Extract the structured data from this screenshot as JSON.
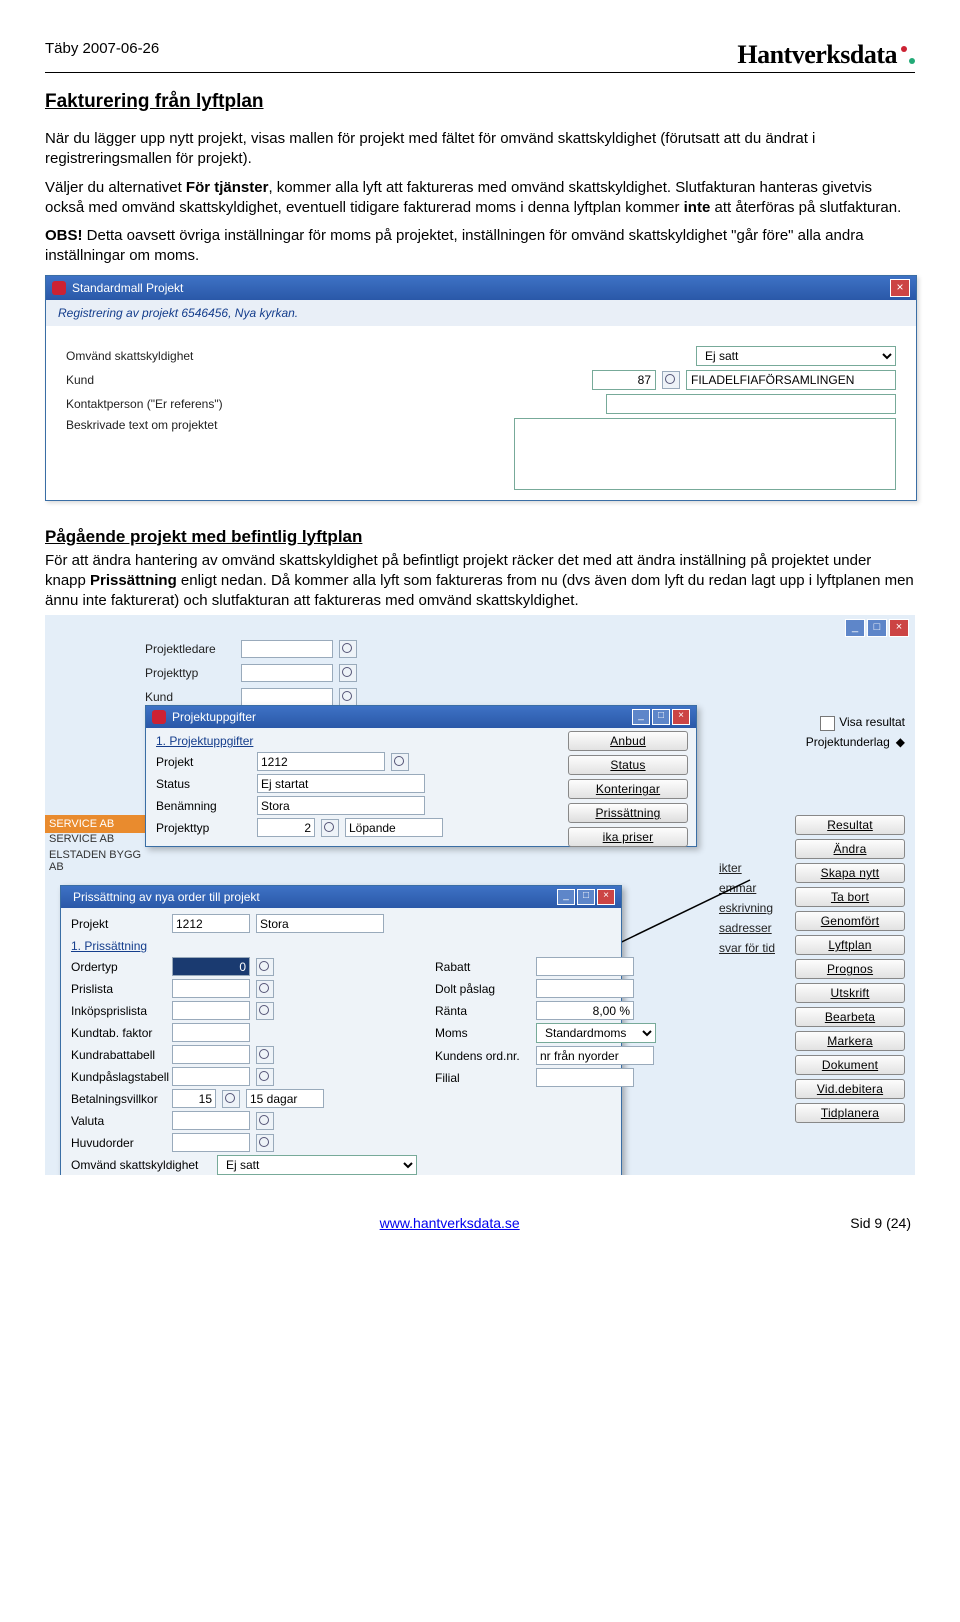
{
  "header": {
    "left": "Täby 2007-06-26",
    "brand": "Hantverksdata"
  },
  "section1": {
    "title": "Fakturering från lyftplan",
    "p1a": "När du lägger upp nytt projekt, visas mallen för projekt med fältet för omvänd skattskyldighet (förutsatt att du ändrat i registreringsmallen för projekt).",
    "p2a": "Väljer du alternativet ",
    "p2b": "För tjänster",
    "p2c": ", kommer alla lyft att faktureras med omvänd skattskyldighet. Slutfakturan hanteras givetvis också med omvänd skattskyldighet, eventuell tidigare fakturerad moms i denna lyftplan kommer ",
    "p2d": "inte",
    "p2e": " att återföras på slutfakturan.",
    "p3a": "OBS!",
    "p3b": " Detta oavsett övriga inställningar för moms på projektet, inställningen för omvänd skattskyldighet \"går före\" alla andra inställningar om moms."
  },
  "shot1": {
    "title": "Standardmall Projekt",
    "subhead": "Registrering av projekt 6546456, Nya kyrkan.",
    "labels": {
      "omvand": "Omvänd skattskyldighet",
      "kund": "Kund",
      "kontakt": "Kontaktperson (\"Er referens\")",
      "beskriv": "Beskrivade text om projektet"
    },
    "values": {
      "omvand": "Ej satt",
      "kund_nr": "87",
      "kund_namn": "FILADELFIAFÖRSAMLINGEN"
    }
  },
  "section2": {
    "title": "Pågående projekt med befintlig lyftplan",
    "p1a": "För att ändra hantering av omvänd skattskyldighet på befintligt projekt räcker det med att ändra inställning på projektet under knapp ",
    "p1b": "Prissättning",
    "p1c": " enligt nedan. Då kommer alla lyft som faktureras from nu (dvs även dom lyft du redan lagt upp i lyftplanen men ännu inte fakturerat) och slutfakturan att faktureras med omvänd skattskyldighet."
  },
  "shot2": {
    "bg_labels": {
      "projled": "Projektledare",
      "projtyp": "Projekttyp",
      "kund": "Kund"
    },
    "orange": "SERVICE AB",
    "gray1": "SERVICE AB",
    "gray2": "ELSTADEN BYGG AB",
    "visa_resultat": "Visa resultat",
    "projunderlag": "Projektunderlag",
    "right_buttons": [
      "Resultat",
      "Ändra",
      "Skapa nytt",
      "Ta bort",
      "Genomfört",
      "Lyftplan",
      "Prognos",
      "Utskrift",
      "Bearbeta",
      "Markera",
      "Dokument",
      "Vid.debitera",
      "Tidplanera"
    ],
    "mini_right": [
      "ikter",
      "emmar",
      "eskrivning",
      "sadresser",
      "svar för tid"
    ],
    "projuppg": {
      "title": "Projektuppgifter",
      "group": "1. Projektuppgifter",
      "labels": {
        "projekt": "Projekt",
        "status": "Status",
        "benamn": "Benämning",
        "projtyp": "Projekttyp"
      },
      "values": {
        "projekt": "1212",
        "status": "Ej startat",
        "benamn": "Stora",
        "projtyp": "2",
        "projtyp_txt": "Löpande"
      },
      "side_buttons": [
        "Anbud",
        "Status",
        "Konteringar",
        "Prissättning",
        "ika priser"
      ]
    },
    "pris": {
      "title": "Prissättning av nya order till projekt",
      "top": {
        "projekt_lbl": "Projekt",
        "projekt": "1212",
        "namn": "Stora"
      },
      "group": "1. Prissättning",
      "left_labels": [
        "Ordertyp",
        "Prislista",
        "Inköpsprislista",
        "Kundtab. faktor",
        "Kundrabattabell",
        "Kundpåslagstabell",
        "Betalningsvillkor",
        "Valuta",
        "Huvudorder",
        "Omvänd skattskyldighet"
      ],
      "left_values": {
        "ordertyp": "0",
        "betvillkor": "15",
        "betvillkor_txt": "15 dagar",
        "omvand": "Ej satt"
      },
      "right_labels": [
        "Rabatt",
        "Dolt påslag",
        "Ränta",
        "Moms",
        "Kundens ord.nr.",
        "Filial"
      ],
      "right_values": {
        "ranta": "8,00 %",
        "moms": "Standardmoms",
        "kundord": "nr från nyorder"
      }
    }
  },
  "footer": {
    "url": "www.hantverksdata.se",
    "page": "Sid 9 (24)"
  }
}
